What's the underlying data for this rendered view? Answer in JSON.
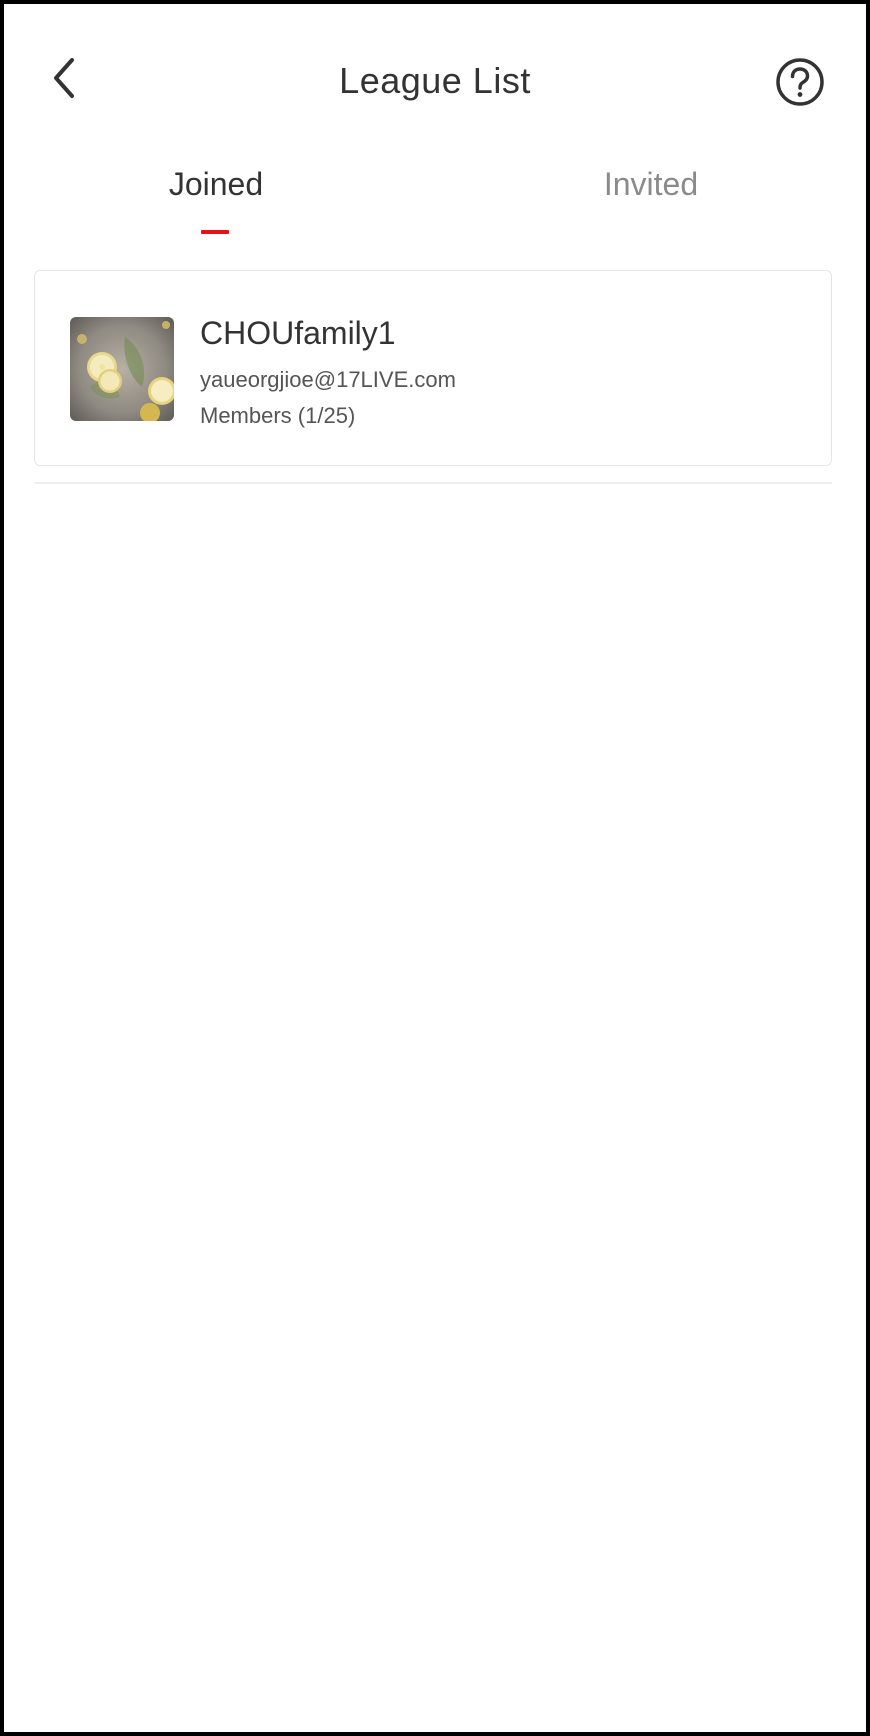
{
  "header": {
    "title": "League List",
    "back_icon": "chevron-left-icon",
    "help_icon": "question-circle-icon"
  },
  "tabs": [
    {
      "label": "Joined",
      "active": true
    },
    {
      "label": "Invited",
      "active": false
    }
  ],
  "colors": {
    "accent": "#e4131a",
    "text_primary": "#333333",
    "text_inactive": "#8a8a8a"
  },
  "leagues": [
    {
      "name": "CHOUfamily1",
      "email": "yaueorgjioe@17LIVE.com",
      "members": "Members (1/25)",
      "avatar_icon": "lemon-photo-avatar"
    }
  ]
}
